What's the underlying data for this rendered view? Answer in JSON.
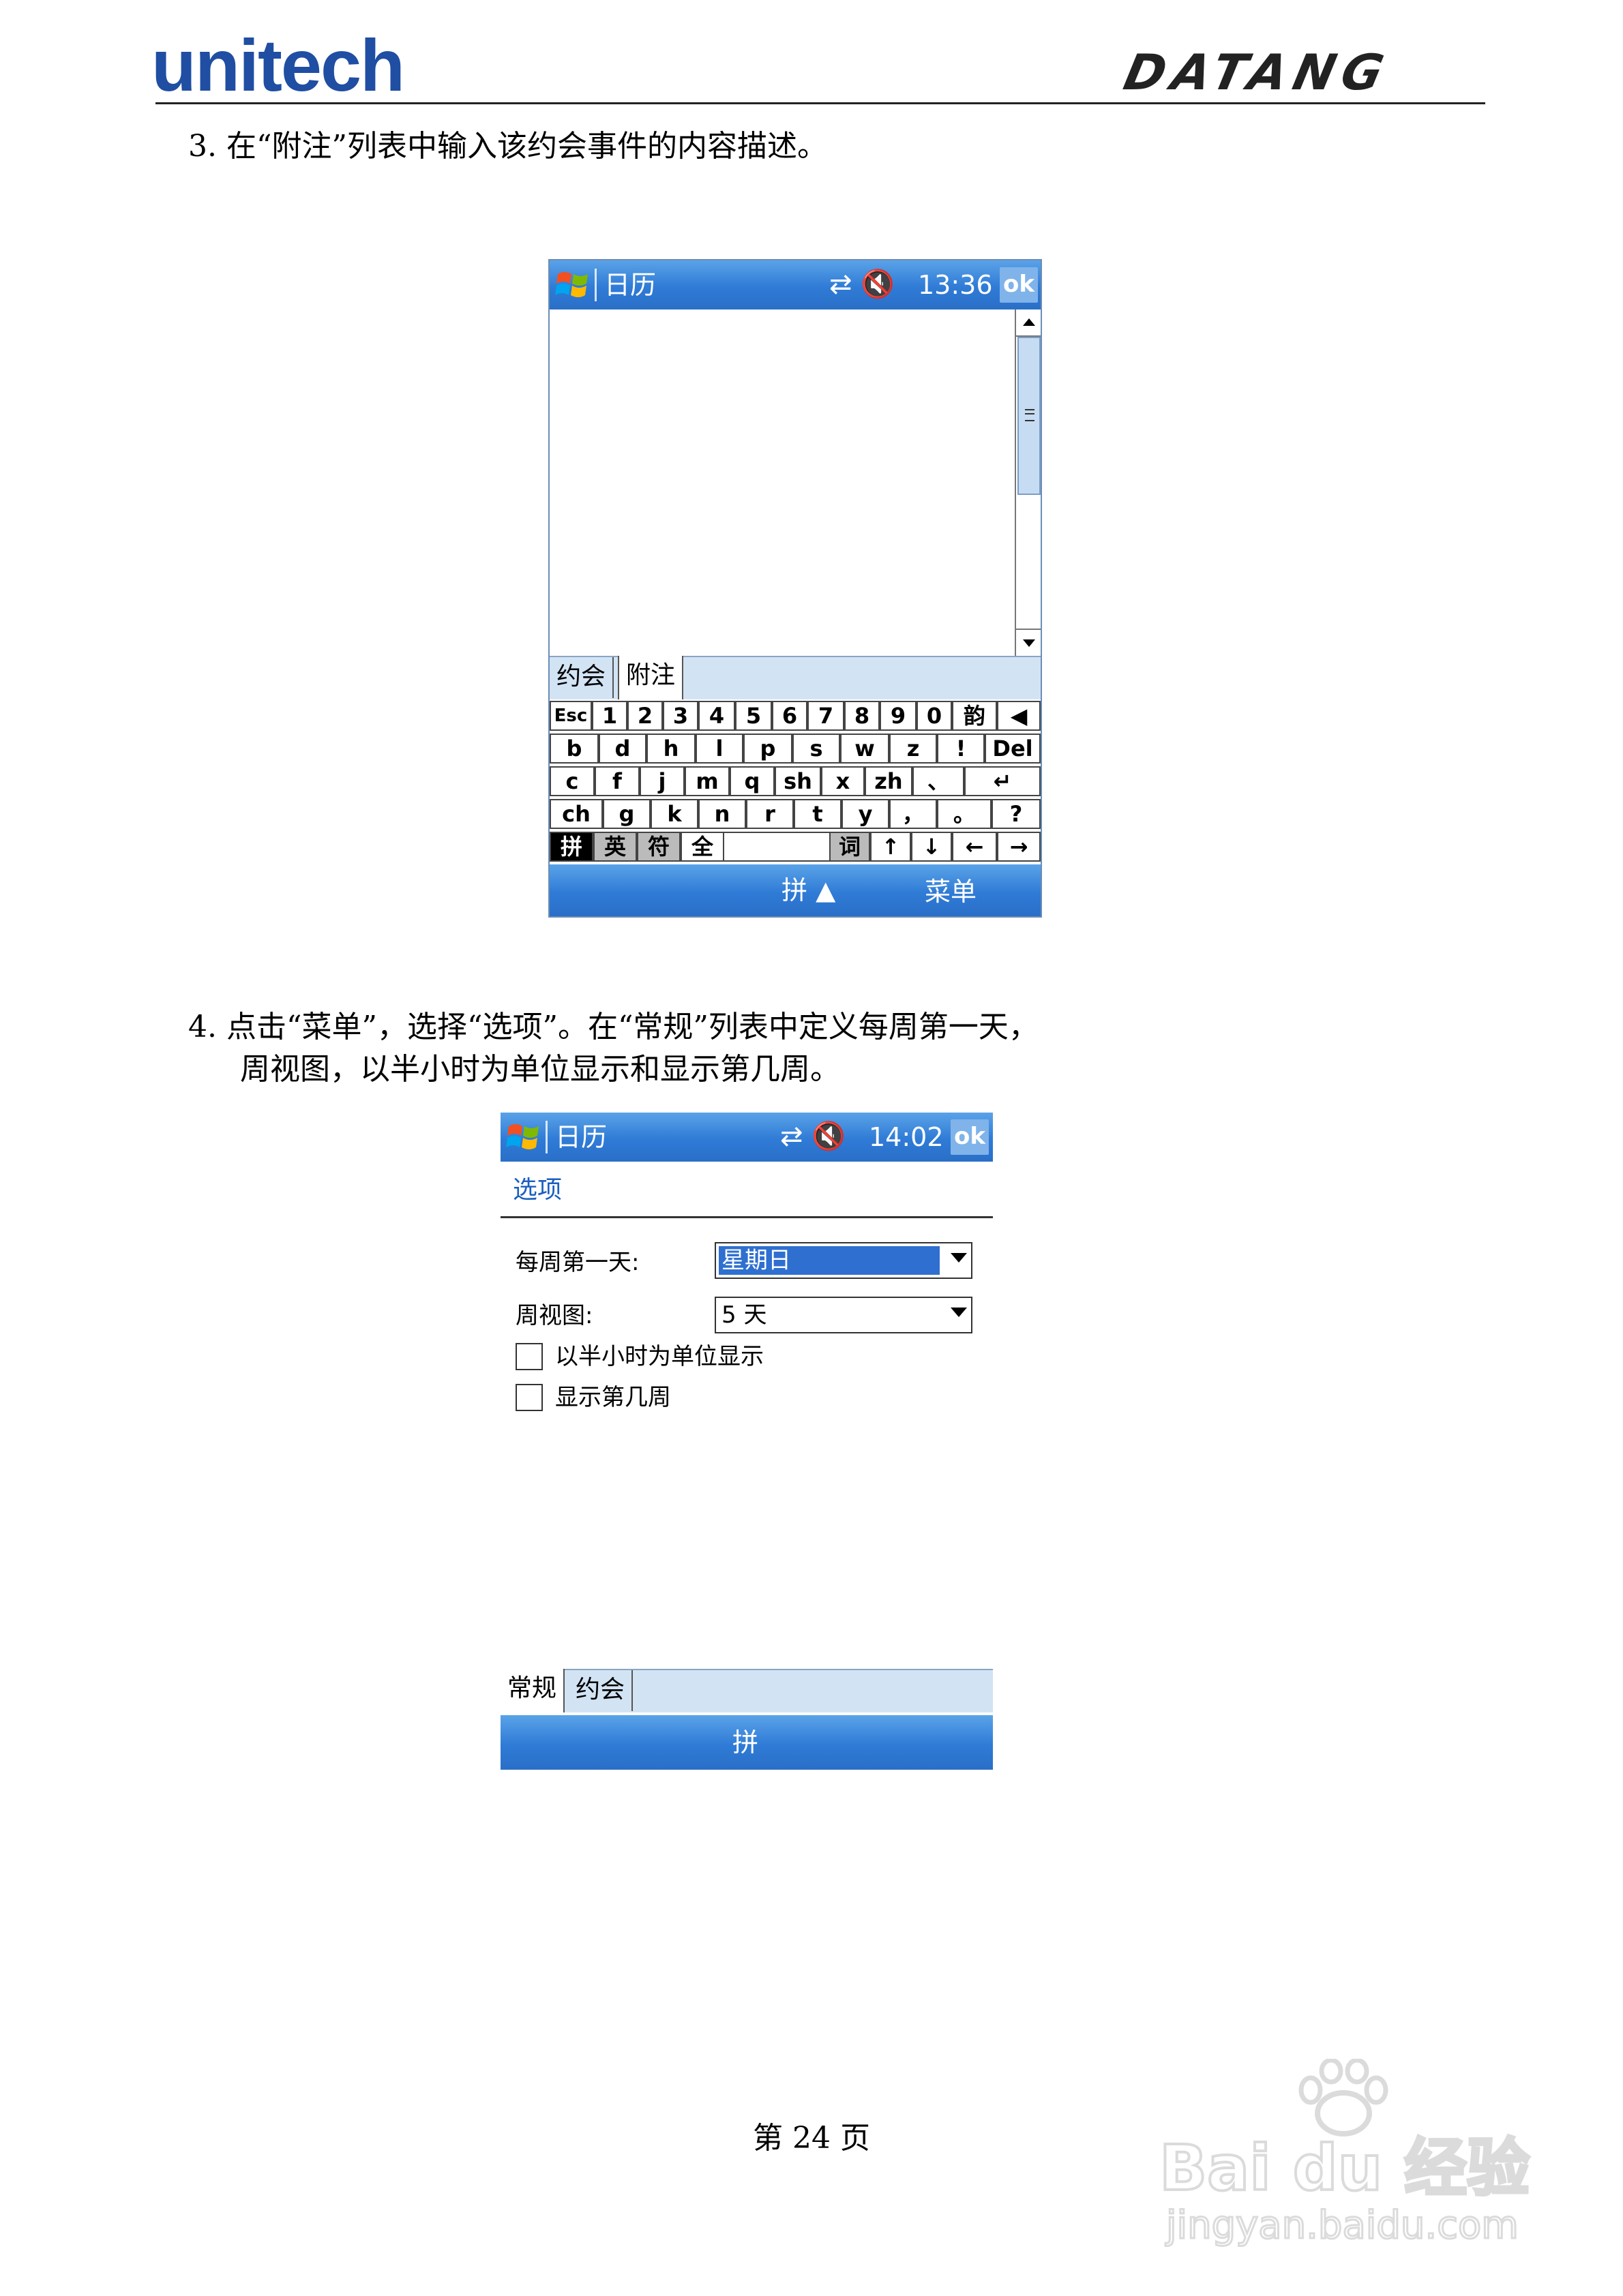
{
  "header": {
    "logo_left": "unitech",
    "logo_right": "DATANG"
  },
  "steps": [
    {
      "text": "3.  在“附注”列表中输入该约会事件的内容描述。"
    },
    {
      "line1": "4.  点击“菜单”，选择“选项”。在“常规”列表中定义每周第一天，",
      "line2": "周视图，以半小时为单位显示和显示第几周。"
    }
  ],
  "screen1": {
    "title": "日历",
    "status_icons": "⇄ 🔇",
    "time": "13:36",
    "ok": "ok",
    "tabs": [
      "约会",
      "附注"
    ],
    "keyboard": {
      "row1": [
        "Esc",
        "1",
        "2",
        "3",
        "4",
        "5",
        "6",
        "7",
        "8",
        "9",
        "0",
        "韵",
        "◀"
      ],
      "row2": [
        "b",
        "d",
        "h",
        "l",
        "p",
        "s",
        "w",
        "z",
        "!",
        "Del"
      ],
      "row3": [
        "c",
        "f",
        "j",
        "m",
        "q",
        "sh",
        "x",
        "zh",
        "、",
        "↵"
      ],
      "row4": [
        "ch",
        "g",
        "k",
        "n",
        "r",
        "t",
        "y",
        "，",
        "。",
        "?"
      ],
      "row5": [
        "拼",
        "英",
        "符",
        "全",
        "",
        "词",
        "↑",
        "↓",
        "←",
        "→"
      ]
    },
    "bottom_left": "拼 ▲",
    "bottom_right": "菜单"
  },
  "screen2": {
    "title": "日历",
    "status_icons": "⇄ 🔇",
    "time": "14:02",
    "ok": "ok",
    "section": "选项",
    "first_day_label": "每周第一天:",
    "first_day_value": "星期日",
    "week_view_label": "周视图:",
    "week_view_value": "5 天",
    "check1": "以半小时为单位显示",
    "check2": "显示第几周",
    "tabs": [
      "常规",
      "约会"
    ],
    "bottom_center": "拼"
  },
  "page_number": "第 24 页",
  "watermark": {
    "brand": "Bai du 经验",
    "url": "jingyan.baidu.com"
  }
}
